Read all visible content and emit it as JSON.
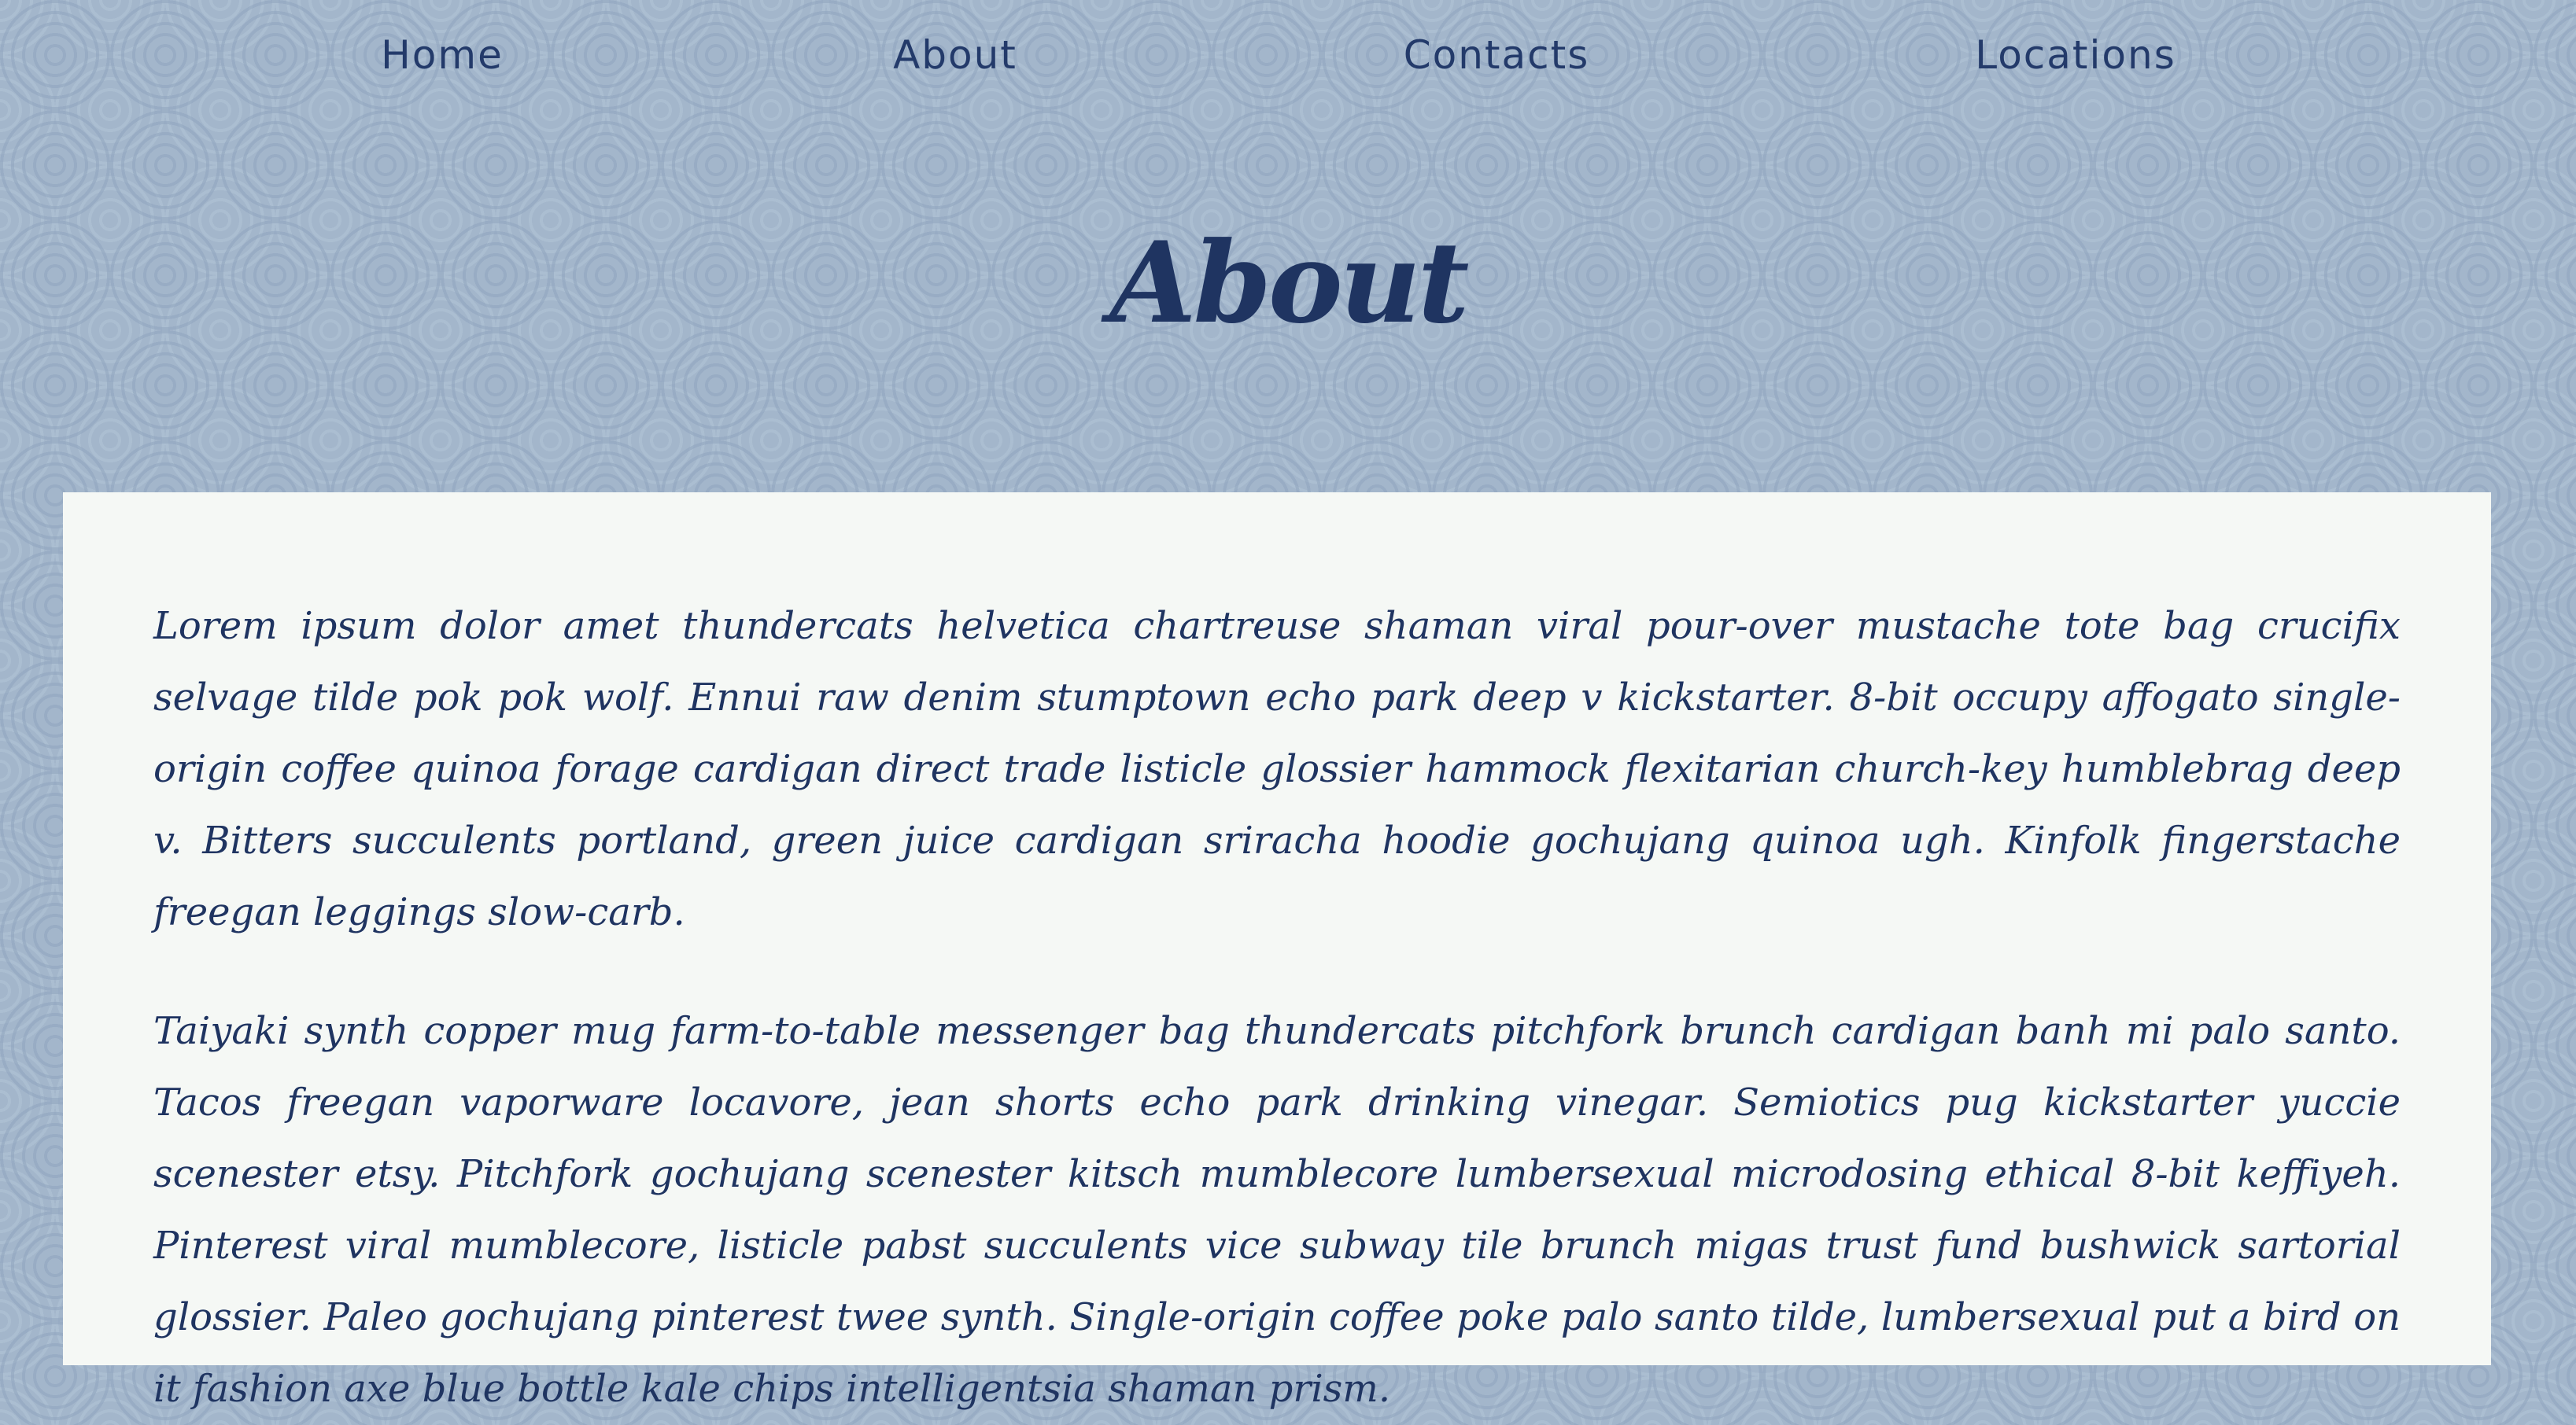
{
  "nav": {
    "items": [
      {
        "label": "Home"
      },
      {
        "label": "About"
      },
      {
        "label": "Contacts"
      },
      {
        "label": "Locations"
      }
    ]
  },
  "page": {
    "title": "About"
  },
  "content": {
    "paragraphs": [
      "Lorem ipsum dolor amet thundercats helvetica chartreuse shaman viral pour-over mustache tote bag crucifix selvage tilde pok pok wolf. Ennui raw denim stumptown echo park deep v kickstarter. 8-bit occupy affogato single-origin coffee quinoa forage cardigan direct trade listicle glossier hammock flexitarian church-key humblebrag deep v. Bitters succulents portland, green juice cardigan sriracha hoodie gochujang quinoa ugh. Kinfolk fingerstache freegan leggings slow-carb.",
      "Taiyaki synth copper mug farm-to-table messenger bag thundercats pitchfork brunch cardigan banh mi palo santo. Tacos freegan vaporware locavore, jean shorts echo park drinking vinegar. Semiotics pug kickstarter yuccie scenester etsy. Pitchfork gochujang scenester kitsch mumblecore lumbersexual microdosing ethical 8-bit keffiyeh. Pinterest viral mumblecore, listicle pabst succulents vice subway tile brunch migas trust fund bushwick sartorial glossier. Paleo gochujang pinterest twee synth. Single-origin coffee poke palo santo tilde, lumbersexual put a bird on it fashion axe blue bottle kale chips intelligentsia shaman prism."
    ]
  },
  "colors": {
    "background": "#a3b6cb",
    "text": "#1f3461",
    "panel": "#f5f8f5"
  }
}
